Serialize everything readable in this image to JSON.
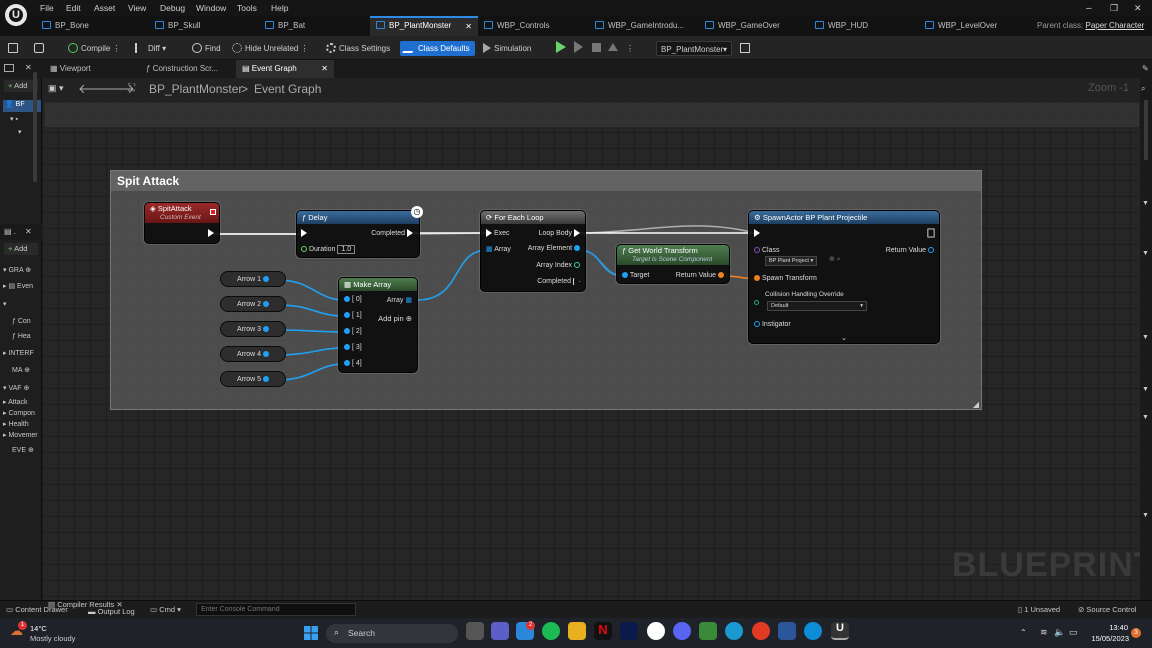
{
  "menu": [
    "File",
    "Edit",
    "Asset",
    "View",
    "Debug",
    "Window",
    "Tools",
    "Help"
  ],
  "tabs": [
    "BP_Bone",
    "BP_Skull",
    "BP_Bat",
    "BP_PlantMonster",
    "WBP_Controls",
    "WBP_GameIntrodu...",
    "WBP_GameOver",
    "WBP_HUD",
    "WBP_LevelOver"
  ],
  "parent_class_label": "Parent class:",
  "parent_class_value": "Paper Character",
  "window_controls": [
    "–",
    "❐",
    "✕"
  ],
  "toolbar": {
    "compile": "Compile",
    "diff": "Diff",
    "find": "Find",
    "hide_unrelated": "Hide Unrelated",
    "class_settings": "Class Settings",
    "class_defaults": "Class Defaults",
    "simulation": "Simulation",
    "debug_object": "BP_PlantMonster"
  },
  "sidebar": {
    "add": "Add",
    "add2": "Add",
    "item_bp": "BF",
    "item_gra": "GRA",
    "item_even": "Even",
    "item_con": "Con",
    "item_hea": "Hea",
    "item_interf": "INTERF",
    "item_ma": "MA",
    "item_var": "VAF",
    "cat_attack": "Attack",
    "cat_component": "Compon",
    "cat_health": "Health",
    "cat_movement": "Movemer",
    "item_eve": "EVE"
  },
  "doctabs": [
    "Viewport",
    "Construction Scr...",
    "Event Graph"
  ],
  "breadcrumb": {
    "root": "BP_PlantMonster",
    "separator": ">",
    "current": "Event Graph",
    "zoom": "Zoom -1"
  },
  "graph": {
    "watermark": "BLUEPRINT",
    "comment_title": "Spit Attack",
    "event_node": {
      "title": "SpitAttack",
      "subtitle": "Custom Event"
    },
    "delay_node": {
      "title": "Delay",
      "completed": "Completed",
      "duration_label": "Duration",
      "duration_value": "1.0"
    },
    "foreach_node": {
      "title": "For Each Loop",
      "exec": "Exec",
      "array": "Array",
      "loop_body": "Loop Body",
      "array_element": "Array Element",
      "array_index": "Array Index",
      "completed": "Completed"
    },
    "gwt_node": {
      "title": "Get World Transform",
      "subtitle": "Target is Scene Component",
      "target": "Target",
      "return_value": "Return Value"
    },
    "spawn_node": {
      "title": "SpawnActor BP Plant Projectile",
      "class_label": "Class",
      "class_value": "BP Plant Project",
      "return_value": "Return Value",
      "spawn_transform": "Spawn Transform",
      "collision": "Collision Handling Override",
      "collision_value": "Default",
      "instigator": "Instigator"
    },
    "make_array": {
      "title": "Make Array",
      "array": "Array",
      "add_pin": "Add pin",
      "pins": [
        "[ 0]",
        "[ 1]",
        "[ 2]",
        "[ 3]",
        "[ 4]"
      ]
    },
    "arrows": [
      "Arrow 1",
      "Arrow 2",
      "Arrow 3",
      "Arrow 4",
      "Arrow 5"
    ]
  },
  "statusbar": {
    "content_drawer": "Content Drawer",
    "compiler_results": "Compiler Results",
    "output_log": "Output Log",
    "cmd": "Cmd",
    "console_placeholder": "Enter Console Command",
    "unsaved": "1 Unsaved",
    "source_control": "Source Control"
  },
  "taskbar": {
    "temp": "14°C",
    "weather": "Mostly cloudy",
    "search": "Search",
    "time": "13:40",
    "date": "15/05/2023",
    "badge_weather": "1",
    "badge_mail": "2",
    "badge_notify": "3"
  },
  "colors": {
    "accent": "#1f6fd1",
    "event_red": "#8a1e1e",
    "function_blue": "#2a5a88",
    "pure_green": "#3a6a3a",
    "pin_blue": "#1da1f2",
    "pin_orange": "#f08020"
  }
}
